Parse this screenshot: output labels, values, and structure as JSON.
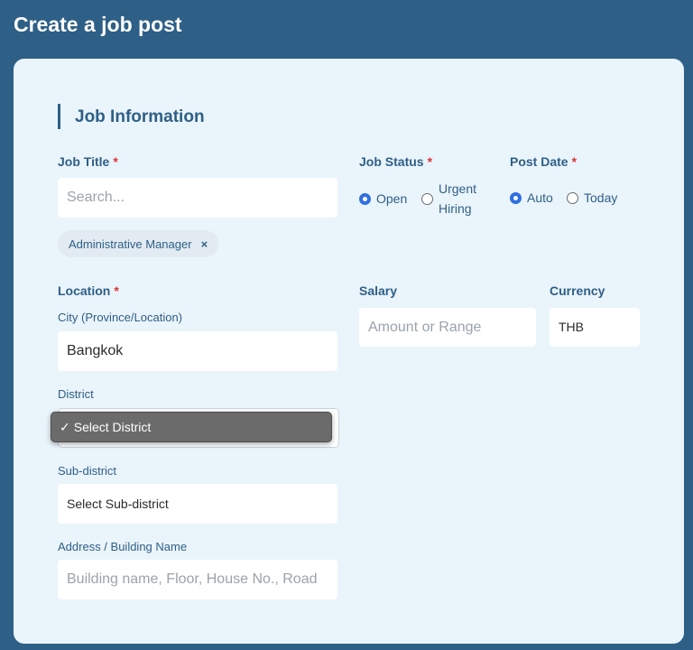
{
  "page_title": "Create a job post",
  "section_title": "Job Information",
  "job_title": {
    "label": "Job Title",
    "required": "*",
    "placeholder": "Search...",
    "chip": "Administrative Manager",
    "chip_close": "×"
  },
  "job_status": {
    "label": "Job Status",
    "required": "*",
    "options": [
      "Open",
      "Urgent",
      "Hiring"
    ],
    "selected": "Open"
  },
  "post_date": {
    "label": "Post Date",
    "required": "*",
    "options": [
      "Auto",
      "Today"
    ],
    "selected": "Auto"
  },
  "location": {
    "label": "Location",
    "required": "*",
    "city_label": "City (Province/Location)",
    "city_value": "Bangkok",
    "district_label": "District",
    "district_check": "✓",
    "district_selected": "Select District",
    "subdistrict_label": "Sub-district",
    "subdistrict_value": "Select Sub-district",
    "address_label": "Address / Building Name",
    "address_placeholder": "Building name, Floor, House No., Road"
  },
  "salary": {
    "label": "Salary",
    "placeholder": "Amount or Range"
  },
  "currency": {
    "label": "Currency",
    "value": "THB"
  }
}
